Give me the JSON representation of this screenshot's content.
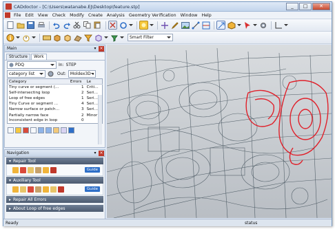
{
  "window": {
    "title": "CADdoctor - [C:\\Users\\watanabe.EJ\\Desktop\\feature.stp]",
    "min": "_",
    "max": "□",
    "close": "✕"
  },
  "menu": [
    "File",
    "Edit",
    "View",
    "Check",
    "Modify",
    "Create",
    "Analysis",
    "Geometry Verification",
    "Window",
    "Help"
  ],
  "toolbar2": {
    "filter_value": "Smart Filter"
  },
  "main_panel": {
    "title": "Main",
    "tabs": [
      "Structure",
      "Work"
    ],
    "source_value": "PDQ",
    "in_label": "In:",
    "in_value": "STEP",
    "category_value": "category list",
    "out_label": "Out:",
    "out_value": "Moldex3D"
  },
  "error_table": {
    "columns": [
      "Category",
      "Errors",
      "Le"
    ],
    "rows": [
      [
        "Tiny curve or segment (…",
        "1",
        "Criti…"
      ],
      [
        "Self-intersecting loop",
        "2",
        "Seri…"
      ],
      [
        "Loop of free edges",
        "1",
        "Seri…"
      ],
      [
        "Tiny Curve or segment …",
        "4",
        "Seri…"
      ],
      [
        "Narrow surface or patch…",
        "3",
        "Seri…"
      ],
      [
        "Partially narrow face",
        "2",
        "Minor"
      ],
      [
        "Inconsistent edge in loop",
        "0",
        ""
      ]
    ]
  },
  "navigation": {
    "title": "Navigation",
    "sections": [
      "Repair Tool",
      "Auxiliary Tool",
      "Repair All Errors",
      "About Loop of free edges"
    ],
    "guide_label": "Guide"
  },
  "status": {
    "left": "Ready",
    "right": "status"
  },
  "colors": {
    "accent": "#c0392b",
    "highlight": "#e0202a",
    "mesh": "#2f3f4a"
  }
}
